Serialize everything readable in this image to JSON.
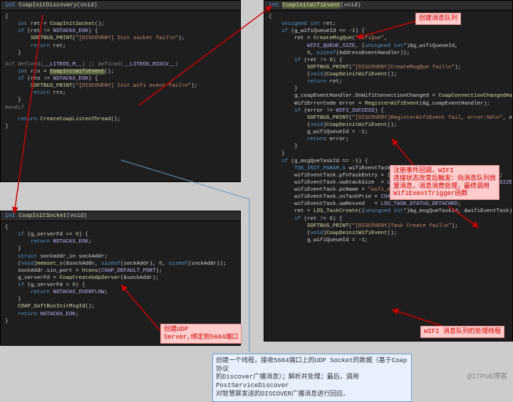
{
  "panel1": {
    "sig_int": "int ",
    "sig_fn": "CoapInitDiscovery",
    "sig_void": "(void)",
    "l1": "{",
    "l2a": "    int ",
    "l2b": "ret = ",
    "l2c": "CoapInitSocket",
    "l2d": "();",
    "l3a": "    if ",
    "l3b": "(ret != ",
    "l3c": "NSTACKX_EOK",
    "l3d": ") {",
    "l4a": "        SOFTBUS_PRINT",
    "l4b": "(",
    "l4c": "\"[DISCOVERY] Init socket fail\\n\"",
    "l4d": ");",
    "l5a": "        return ",
    "l5b": "ret;",
    "l6": "    }",
    "l7a": "#if defined(",
    "l7b": "__LITEOS_M__",
    "l7c": ") || defined(",
    "l7d": "__LITEOS_RISCV__",
    "l7e": ")",
    "l8a": "    int ",
    "l8b": "rtn = ",
    "l8c": "CoapInitWifiEvent",
    "l8d": "();",
    "l9a": "    if ",
    "l9b": "(rtn != ",
    "l9c": "NSTACKX_EOK",
    "l9d": ") {",
    "l10a": "        SOFTBUS_PRINT",
    "l10b": "(",
    "l10c": "\"[DISCOVERY] Init wifi event fail\\n\"",
    "l10d": ");",
    "l11a": "        return ",
    "l11b": "rtn;",
    "l12": "    }",
    "l13": "#endif",
    "l14a": "    return ",
    "l14b": "CreateCoapListenThread",
    "l14c": "();",
    "l15": "}"
  },
  "panel2": {
    "sig_int": "int ",
    "sig_fn": "CoapInitSocket",
    "sig_void": "(void)",
    "l1": "{",
    "l2a": "    if ",
    "l2b": "(g_serverFd >= ",
    "l2c": "0",
    "l2d": ") {",
    "l3a": "        return ",
    "l3b": "NSTACKX_EOK",
    "l3c": ";",
    "l4": "    }",
    "l5a": "    struct ",
    "l5b": "sockaddr_in sockAddr;",
    "l6a": "    (",
    "l6b": "void",
    "l6c": ")",
    "l6d": "memset_s",
    "l6e": "(&sockAddr, ",
    "l6f": "sizeof",
    "l6g": "(sockAddr), ",
    "l6h": "0",
    "l6i": ", ",
    "l6j": "sizeof",
    "l6k": "(sockAddr));",
    "l7a": "    sockAddr.sin_port = ",
    "l7b": "htons",
    "l7c": "(",
    "l7d": "COAP_DEFAULT_PORT",
    "l7e": ");",
    "l8a": "    g_serverFd = ",
    "l8b": "CoapCreateUdpServer",
    "l8c": "(&sockAddr);",
    "l9a": "    if ",
    "l9b": "(g_serverFd < ",
    "l9c": "0",
    "l9d": ") {",
    "l10a": "        return ",
    "l10b": "NSTACKX_OVERFLOW",
    "l10c": ";",
    "l11": "    }",
    "l12a": "    COAP_SoftBusInitMsgId",
    "l12b": "();",
    "l13a": "    return ",
    "l13b": "NSTACKX_EOK",
    "l13c": ";",
    "l14": "}"
  },
  "panel3": {
    "sig_int": "int ",
    "sig_fn": "CoapInitWifiEvent",
    "sig_void": "(void)",
    "l1": "{",
    "l2a": "    unsigned int ",
    "l2b": "ret;",
    "l3a": "    if ",
    "l3b": "(g_wifiQueueId == ",
    "l3c": "-1",
    "l3d": ") {",
    "l4a": "        ret = ",
    "l4b": "CreateMsgQue",
    "l4c": "(",
    "l4d": "\"wifiQue\"",
    "l4e": ",",
    "l5a": "            WIFI_QUEUE_SIZE",
    "l5b": ", (",
    "l5c": "unsigned int",
    "l5d": "*)&g_wifiQueueId,",
    "l6a": "            0",
    "l6b": ", ",
    "l6c": "sizeof",
    "l6d": "(AddressEventHandler));",
    "l7a": "        if ",
    "l7b": "(ret != ",
    "l7c": "0",
    "l7d": ") {",
    "l8a": "            SOFTBUS_PRINT",
    "l8b": "(",
    "l8c": "\"[DISCOVERY]CreateMsgQue fail\\n\"",
    "l8d": ");",
    "l9a": "            (",
    "l9b": "void",
    "l9c": ")",
    "l9d": "CoapDeinitWifiEvent",
    "l9e": "();",
    "l10a": "            return ",
    "l10b": "ret;",
    "l11": "        }",
    "l12": "",
    "l13a": "        g_coapEventHandler.OnWifiConnectionChanged = ",
    "l13b": "CoapConnectionChangedHandler",
    "l13c": ";",
    "l14a": "        WifiErrorCode error = ",
    "l14b": "RegisterWifiEvent",
    "l14c": "(&g_coapEventHandler);",
    "l15a": "        if ",
    "l15b": "(error != ",
    "l15c": "WIFI_SUCCESS",
    "l15d": ") {",
    "l16a": "            SOFTBUS_PRINT",
    "l16b": "(",
    "l16c": "\"[DISCOVERY]RegisterWifiEvent fail, error:%d\\n\"",
    "l16d": ", error);",
    "l17a": "            (",
    "l17b": "void",
    "l17c": ")",
    "l17d": "CoapDeinitWifiEvent",
    "l17e": "();",
    "l18a": "            g_wifiQueueId = ",
    "l18b": "-1",
    "l18c": ";",
    "l19a": "            return ",
    "l19b": "error;",
    "l20": "        }",
    "l21": "    }",
    "l22": "",
    "l23a": "    if ",
    "l23b": "(g_msgQueTaskId == ",
    "l23c": "-1",
    "l23d": ") {",
    "l24a": "        TSK_INIT_PARAM_S ",
    "l24b": "wifiEventTask;",
    "l25a": "        wifiEventTask.pfnTaskEntry = (",
    "l25b": "TSK_ENTRY_FUNC",
    "l25c": ")",
    "l25d": "CoapWifiEventThread",
    "l25e": ";",
    "l26a": "        wifiEventTask.uwStackSize  = ",
    "l26b": "LOSCFG_BASE_CORE_TSK_DEFAULT_STACK_SIZE",
    "l26c": ";",
    "l27a": "        wifiEventTask.pcName = ",
    "l27b": "\"wifi_event\"",
    "l27c": ";",
    "l28a": "        wifiEventTask.usTaskPrio = ",
    "l28b": "COAP_DEFAULT_PRIO",
    "l28c": ";",
    "l29a": "        wifiEventTask.uwResved   = ",
    "l29b": "LOS_TASK_STATUS_DETACHED",
    "l29c": ";",
    "l30a": "        ret = ",
    "l30b": "LOS_TaskCreate",
    "l30c": "((",
    "l30d": "unsigned int",
    "l30e": "*)&g_msgQueTaskId, &wifiEventTask);",
    "l31a": "        if ",
    "l31b": "(ret != ",
    "l31c": "0",
    "l31d": ") {",
    "l32a": "            SOFTBUS_PRINT",
    "l32b": "(",
    "l32c": "\"[DISCOVERY]Task Create fail\\n\"",
    "l32d": ");",
    "l33a": "            (",
    "l33b": "void",
    "l33c": ")",
    "l33d": "CoapDeinitWifiEvent",
    "l33e": "();",
    "l34a": "            g_wifiQueueId = ",
    "l34b": "-1",
    "l34c": ";"
  },
  "callouts": {
    "c1": "创建消息队列",
    "c2": "注册事件回调，WIFI\n连接状态改变后触发：向消息队列放\n置消息，消息消费处理，最终调用\nWifiEventTrigger函数",
    "c3": "WIFI 消息队列的处理线程",
    "c4": "创建UDP\nServer,绑定到5684端口"
  },
  "infobox": "创建一个线程，接收5684端口上的UDP Socket的数据（基于Coap协议\n的Discover广播消息）；解析并处理；最后，调用PostServiceDiscover\n对智慧屏发送的DISCOVER广播消息进行回应。",
  "watermark": "@ITPUB博客"
}
